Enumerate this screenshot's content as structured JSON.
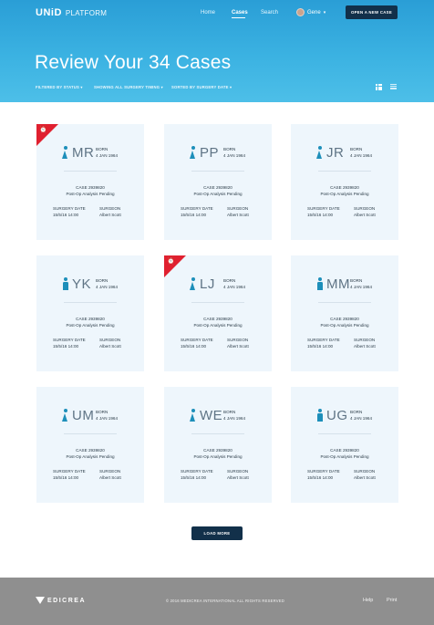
{
  "header": {
    "logo_main": "UNiD",
    "logo_sub": "PLATFORM",
    "nav": [
      {
        "label": "Home"
      },
      {
        "label": "Cases"
      },
      {
        "label": "Search"
      }
    ],
    "user": {
      "name": "Gene",
      "chevron": "▾"
    },
    "open_case_button": "OPEN A NEW CASE",
    "page_title": "Review Your 34 Cases",
    "filters": [
      {
        "label": "FILTERED BY STATUS ▾"
      },
      {
        "label": "SHOWING ALL SURGERY TIMING ▾"
      },
      {
        "label": "SORTED BY SURGERY DATE ▾"
      }
    ],
    "view_icons": [
      "grid-view-icon",
      "list-view-icon"
    ]
  },
  "cases": [
    {
      "initials": "MR",
      "gender": "female",
      "alert": true,
      "born_label": "BORN",
      "born_date": "4 JAN 1964",
      "case_no": "CASE 2939820",
      "status": "Post-Op Analysis Pending",
      "surgery_date_label": "SURGERY DATE",
      "surgery_date": "15/5/16 14:00",
      "surgeon_label": "SURGEON",
      "surgeon": "Albert Scott"
    },
    {
      "initials": "PP",
      "gender": "female",
      "alert": false,
      "born_label": "BORN",
      "born_date": "4 JAN 1964",
      "case_no": "CASE 2939820",
      "status": "Post-Op Analysis Pending",
      "surgery_date_label": "SURGERY DATE",
      "surgery_date": "15/5/16 14:00",
      "surgeon_label": "SURGEON",
      "surgeon": "Albert Scott"
    },
    {
      "initials": "JR",
      "gender": "female",
      "alert": false,
      "born_label": "BORN",
      "born_date": "4 JAN 1964",
      "case_no": "CASE 2939820",
      "status": "Post-Op Analysis Pending",
      "surgery_date_label": "SURGERY DATE",
      "surgery_date": "15/5/16 14:00",
      "surgeon_label": "SURGEON",
      "surgeon": "Albert Scott"
    },
    {
      "initials": "YK",
      "gender": "male",
      "alert": false,
      "born_label": "BORN",
      "born_date": "4 JAN 1964",
      "case_no": "CASE 2939820",
      "status": "Post-Op Analysis Pending",
      "surgery_date_label": "SURGERY DATE",
      "surgery_date": "15/5/16 14:00",
      "surgeon_label": "SURGEON",
      "surgeon": "Albert Scott"
    },
    {
      "initials": "LJ",
      "gender": "female",
      "alert": true,
      "born_label": "BORN",
      "born_date": "4 JAN 1964",
      "case_no": "CASE 2939820",
      "status": "Post-Op Analysis Pending",
      "surgery_date_label": "SURGERY DATE",
      "surgery_date": "15/5/16 14:00",
      "surgeon_label": "SURGEON",
      "surgeon": "Albert Scott"
    },
    {
      "initials": "MM",
      "gender": "male",
      "alert": false,
      "born_label": "BORN",
      "born_date": "4 JAN 1964",
      "case_no": "CASE 2939820",
      "status": "Post-Op Analysis Pending",
      "surgery_date_label": "SURGERY DATE",
      "surgery_date": "15/5/16 14:00",
      "surgeon_label": "SURGEON",
      "surgeon": "Albert Scott"
    },
    {
      "initials": "UM",
      "gender": "female",
      "alert": false,
      "born_label": "BORN",
      "born_date": "4 JAN 1964",
      "case_no": "CASE 2939820",
      "status": "Post-Op Analysis Pending",
      "surgery_date_label": "SURGERY DATE",
      "surgery_date": "15/5/16 14:00",
      "surgeon_label": "SURGEON",
      "surgeon": "Albert Scott"
    },
    {
      "initials": "WE",
      "gender": "female",
      "alert": false,
      "born_label": "BORN",
      "born_date": "4 JAN 1964",
      "case_no": "CASE 2939820",
      "status": "Post-Op Analysis Pending",
      "surgery_date_label": "SURGERY DATE",
      "surgery_date": "15/5/16 14:00",
      "surgeon_label": "SURGEON",
      "surgeon": "Albert Scott"
    },
    {
      "initials": "UG",
      "gender": "male",
      "alert": false,
      "born_label": "BORN",
      "born_date": "4 JAN 1964",
      "case_no": "CASE 2939820",
      "status": "Post-Op Analysis Pending",
      "surgery_date_label": "SURGERY DATE",
      "surgery_date": "15/5/16 14:00",
      "surgeon_label": "SURGEON",
      "surgeon": "Albert Scott"
    }
  ],
  "load_more_button": "LOAD MORE",
  "footer": {
    "logo": "EDICREA",
    "copyright": "© 2016 MEDICREA INTERNATIONAL ALL RIGHTS RESERVED",
    "links": [
      {
        "label": "Help"
      },
      {
        "label": "Print"
      }
    ]
  },
  "colors": {
    "header_gradient_top": "#2a9ed6",
    "header_gradient_bottom": "#4dbfe8",
    "dark_button": "#12304a",
    "card_bg": "#eef6fc",
    "patient_icon": "#1d8fba",
    "alert_ribbon": "#e0202f",
    "footer_bg": "#8f8f8f"
  }
}
